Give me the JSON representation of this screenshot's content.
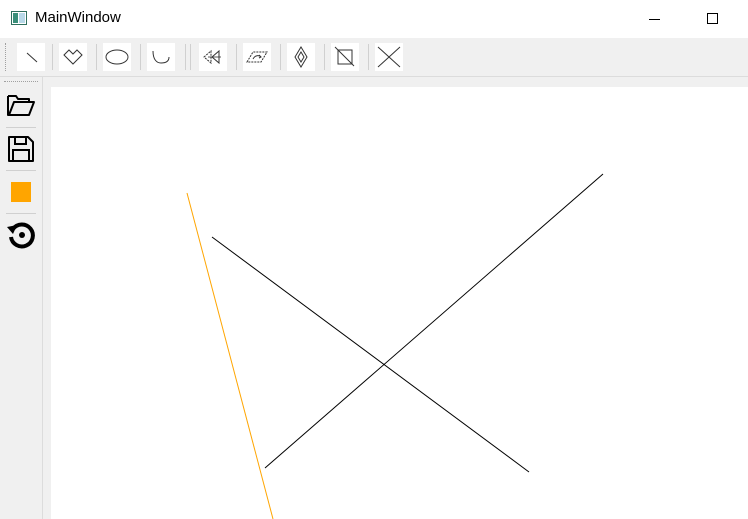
{
  "window": {
    "title": "MainWindow"
  },
  "toolbar_top": {
    "tools": [
      {
        "name": "line",
        "icon": "line-icon"
      },
      {
        "name": "polygon",
        "icon": "polygon-icon"
      },
      {
        "name": "ellipse",
        "icon": "ellipse-icon"
      },
      {
        "name": "curve",
        "icon": "curve-icon"
      },
      {
        "name": "translate",
        "icon": "translate-icon"
      },
      {
        "name": "rotate",
        "icon": "rotate-shape-icon"
      },
      {
        "name": "scale",
        "icon": "scale-icon"
      },
      {
        "name": "clip",
        "icon": "clip-icon"
      },
      {
        "name": "delete",
        "icon": "delete-x-icon"
      }
    ]
  },
  "toolbar_left": {
    "tools": [
      {
        "name": "open",
        "icon": "folder-open-icon"
      },
      {
        "name": "save",
        "icon": "save-icon"
      },
      {
        "name": "color",
        "icon": "color-swatch-icon",
        "color": "#FFA500"
      },
      {
        "name": "reset",
        "icon": "reset-icon"
      }
    ]
  },
  "canvas": {
    "background": "#ffffff",
    "shapes": [
      {
        "type": "line",
        "color": "#FFA500"
      },
      {
        "type": "line",
        "color": "#000000"
      },
      {
        "type": "line",
        "color": "#000000"
      }
    ]
  }
}
